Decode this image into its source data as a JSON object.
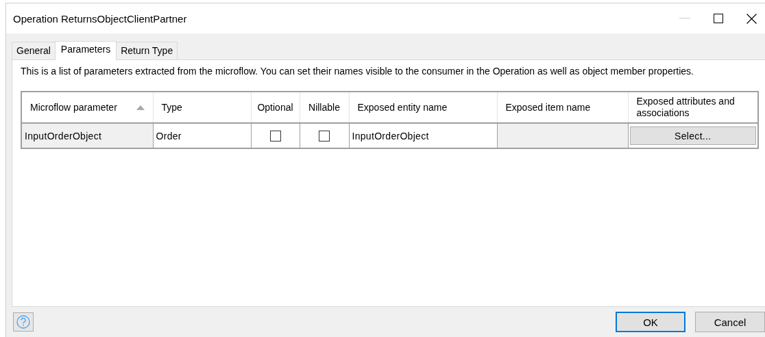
{
  "window": {
    "title": "Operation ReturnsObjectClientPartner",
    "minimize_disabled": true
  },
  "tabs": [
    {
      "label": "General",
      "selected": false
    },
    {
      "label": "Parameters",
      "selected": true
    },
    {
      "label": "Return Type",
      "selected": false
    }
  ],
  "description": "This is a list of parameters extracted from the microflow. You can set their names visible to the consumer in the Operation as well as object member properties.",
  "table": {
    "columns": [
      {
        "label": "Microflow parameter",
        "sorted": true
      },
      {
        "label": "Type",
        "sorted": false
      },
      {
        "label": "Optional",
        "sorted": false
      },
      {
        "label": "Nillable",
        "sorted": false
      },
      {
        "label": "Exposed entity name",
        "sorted": false
      },
      {
        "label": "Exposed item name",
        "sorted": false
      },
      {
        "label": "Exposed attributes and associations",
        "sorted": false
      }
    ],
    "rows": [
      {
        "cells": [
          {
            "kind": "text",
            "text": "InputOrderObject",
            "shaded": true
          },
          {
            "kind": "text",
            "text": "Order",
            "shaded": false
          },
          {
            "kind": "checkbox",
            "checked": false
          },
          {
            "kind": "checkbox",
            "checked": false
          },
          {
            "kind": "text",
            "text": "InputOrderObject",
            "shaded": false
          },
          {
            "kind": "readonly"
          },
          {
            "kind": "button",
            "text": "Select..."
          }
        ]
      }
    ]
  },
  "buttons": [
    {
      "label": "OK",
      "default": true
    },
    {
      "label": "Cancel",
      "default": false
    }
  ]
}
